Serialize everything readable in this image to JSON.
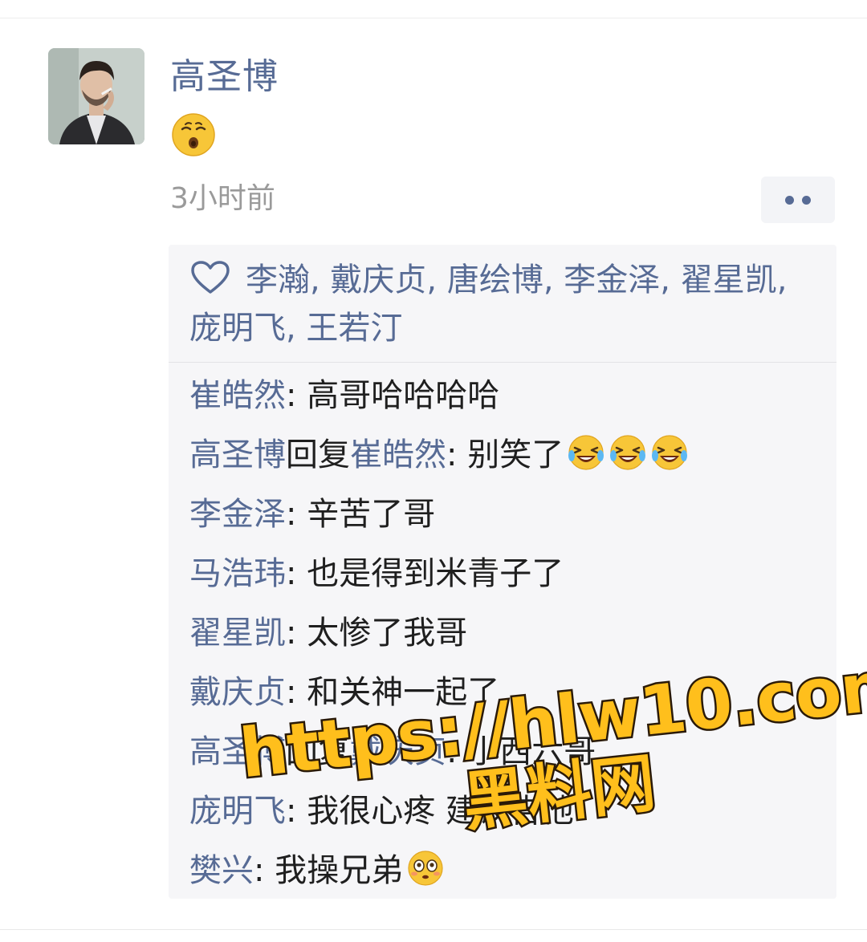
{
  "post": {
    "author": "高圣博",
    "content_emoji_icon": "whistling-face-emoji",
    "time": "3小时前",
    "more_icon": "two-dots-icon"
  },
  "likes": {
    "icon": "heart-outline-icon",
    "names": "李瀚, 戴庆贞, 唐绘博, 李金泽, 翟星凯, 庞明飞, 王若汀"
  },
  "comments": [
    {
      "name": "崔皓然",
      "sep": ": ",
      "text": "高哥哈哈哈哈"
    },
    {
      "name": "高圣博",
      "reply_word": "回复",
      "reply_to": "崔皓然",
      "sep": ": ",
      "text": "别笑了",
      "emojis": [
        "laughing-tears-emoji",
        "laughing-tears-emoji",
        "laughing-tears-emoji"
      ]
    },
    {
      "name": "李金泽",
      "sep": ": ",
      "text": "辛苦了哥"
    },
    {
      "name": "马浩玮",
      "sep": ": ",
      "text": "也是得到米青子了"
    },
    {
      "name": "翟星凯",
      "sep": ": ",
      "text": "太惨了我哥"
    },
    {
      "name": "戴庆贞",
      "sep": ": ",
      "text": "和关神一起了"
    },
    {
      "name": "高圣博",
      "reply_word": "回复",
      "reply_to": "戴庆贞",
      "sep": ": ",
      "text": "小西六哥"
    },
    {
      "name": "庞明飞",
      "sep": ": ",
      "text": "我很心疼 建议告他"
    },
    {
      "name": "樊兴",
      "sep": ": ",
      "text": "我操兄弟",
      "emojis": [
        "flushed-face-emoji"
      ]
    }
  ],
  "watermark": {
    "line1": "https://hlw10.com",
    "line2": "黑料网"
  },
  "colors": {
    "link_blue": "#576b95",
    "time_gray": "#9a9a9a",
    "panel_bg": "#f6f6f8",
    "watermark_fill": "#ffbf1c"
  }
}
